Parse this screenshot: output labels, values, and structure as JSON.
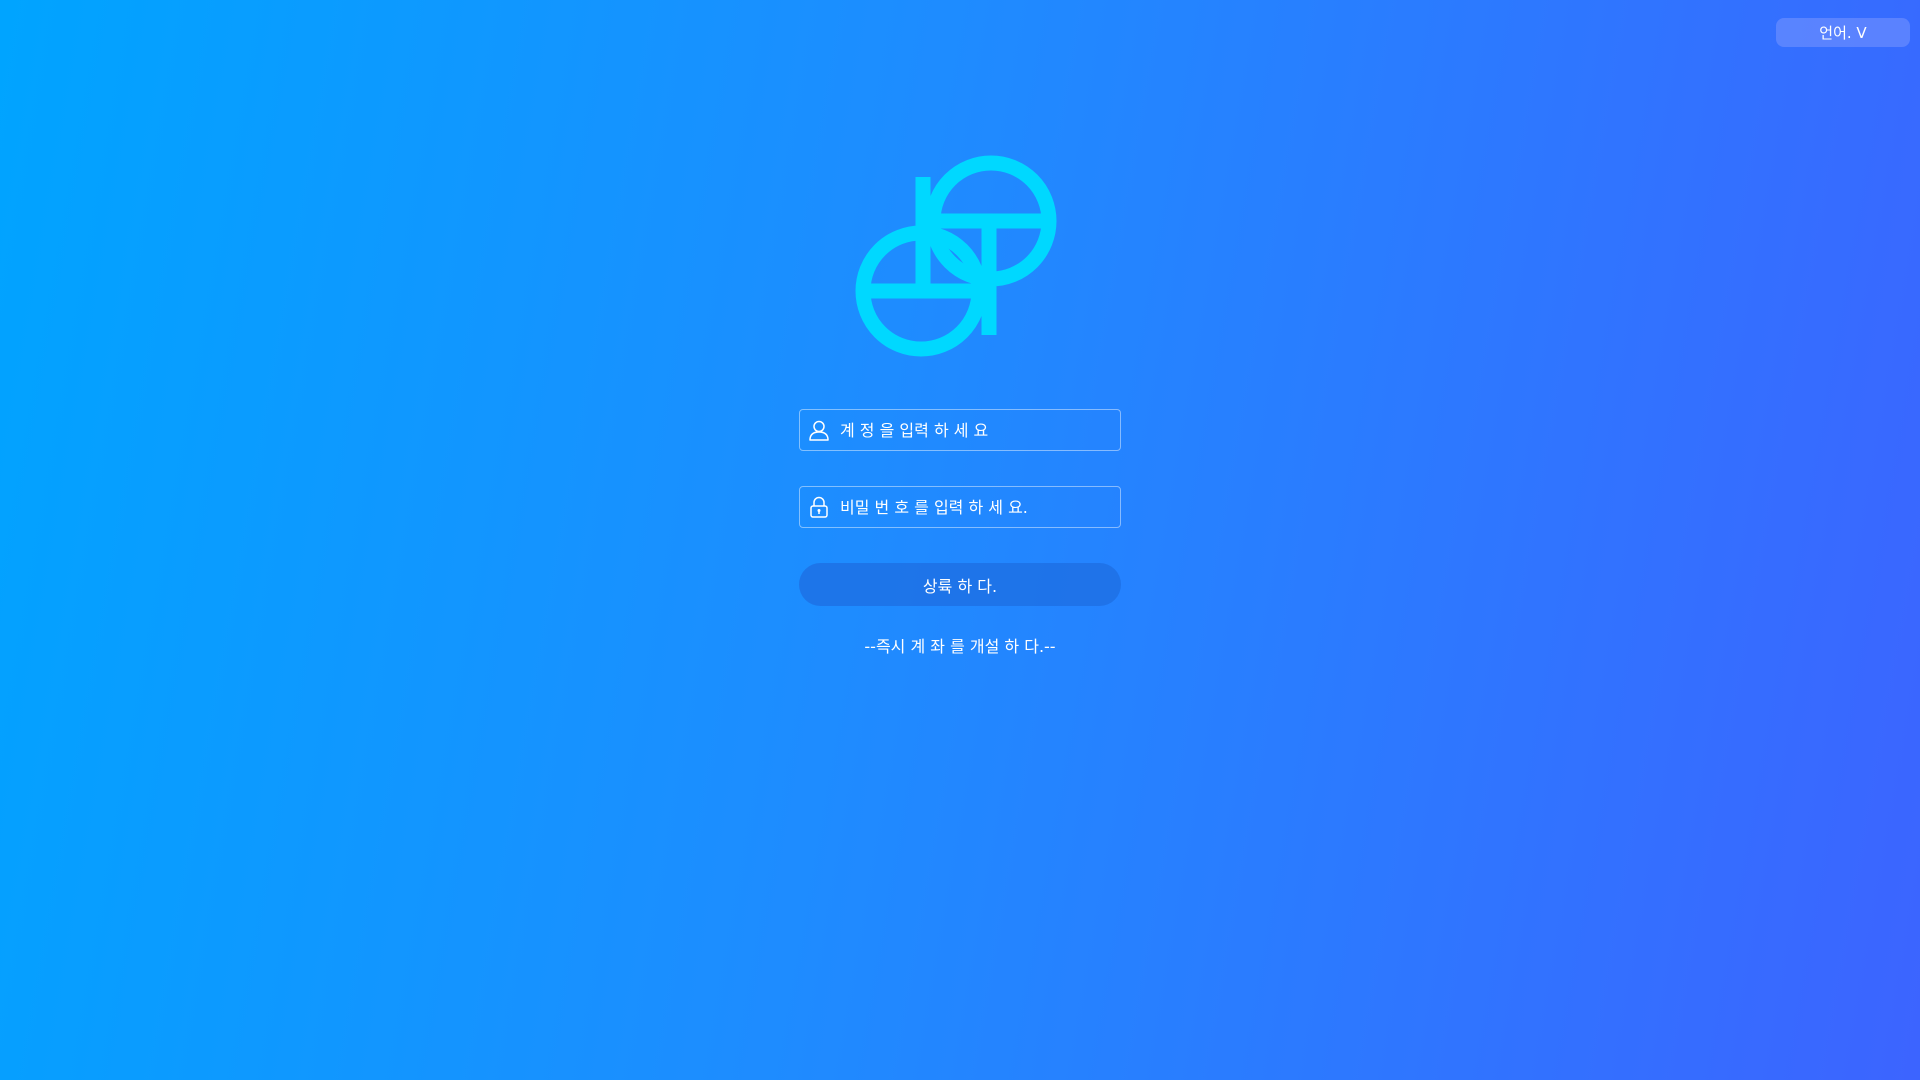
{
  "header": {
    "language_label": "언어. V"
  },
  "logo": {
    "icon": "gemini-logo-icon",
    "color": "#00d8ff"
  },
  "form": {
    "account_placeholder": "계 정 을 입력 하 세 요",
    "password_placeholder": "비밀 번 호 를 입력 하 세 요.",
    "account_icon": "user-icon",
    "password_icon": "lock-icon",
    "login_label": "상륙 하 다.",
    "register_link": "--즉시 계 좌 를 개설 하 다.--"
  },
  "colors": {
    "background_start": "#00a4ff",
    "background_end": "#3c64ff",
    "button": "#1e6ee1"
  }
}
